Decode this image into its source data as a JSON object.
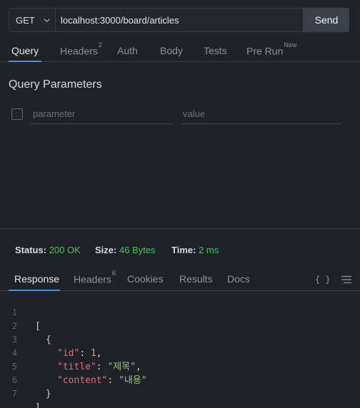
{
  "request": {
    "method": "GET",
    "url": "localhost:3000/board/articles",
    "send_label": "Send"
  },
  "request_tabs": [
    {
      "label": "Query",
      "badge": ""
    },
    {
      "label": "Headers",
      "badge": "2"
    },
    {
      "label": "Auth",
      "badge": ""
    },
    {
      "label": "Body",
      "badge": ""
    },
    {
      "label": "Tests",
      "badge": ""
    },
    {
      "label": "Pre Run",
      "badge": "New"
    }
  ],
  "query": {
    "title": "Query Parameters",
    "param_placeholder": "parameter",
    "value_placeholder": "value"
  },
  "status": {
    "status_label": "Status:",
    "status_value": "200 OK",
    "size_label": "Size:",
    "size_value": "46 Bytes",
    "time_label": "Time:",
    "time_value": "2 ms"
  },
  "response_tabs": [
    {
      "label": "Response",
      "badge": ""
    },
    {
      "label": "Headers",
      "badge": "6"
    },
    {
      "label": "Cookies",
      "badge": ""
    },
    {
      "label": "Results",
      "badge": ""
    },
    {
      "label": "Docs",
      "badge": ""
    }
  ],
  "response_icons": {
    "format": "{ }",
    "menu_icon": "hamburger-menu-icon"
  },
  "response_body": {
    "line_numbers": [
      "1",
      "2",
      "3",
      "4",
      "5",
      "6",
      "7"
    ],
    "open_bracket": "[",
    "open_brace": "{",
    "id_key": "\"id\"",
    "id_value": "1",
    "title_key": "\"title\"",
    "title_value": "\"제목\"",
    "content_key": "\"content\"",
    "content_value": "\"내용\"",
    "close_brace": "}",
    "close_bracket": "]"
  },
  "colors": {
    "accent": "#4b8fd6",
    "status_ok": "#4cbd5b",
    "json_key": "#e06c75",
    "json_string": "#98c379",
    "json_number": "#d19a66"
  }
}
